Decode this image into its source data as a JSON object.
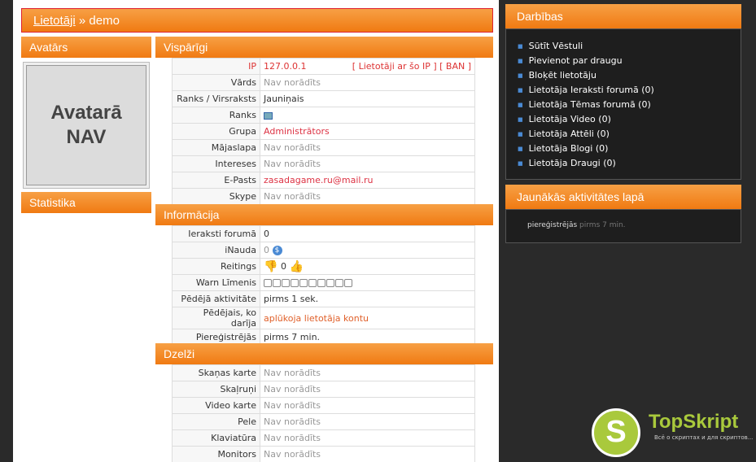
{
  "breadcrumb": {
    "link": "Lietotāji",
    "sep": " » ",
    "current": "demo"
  },
  "headers": {
    "avatars": "Avatārs",
    "visparigi": "Vispārīgi",
    "statistika": "Statistika",
    "informacija": "Informācija",
    "dzelzi": "Dzelži"
  },
  "avatar": {
    "line1": "Avatarā",
    "line2": "NAV"
  },
  "general": [
    {
      "k": "IP",
      "v": "127.0.0.1",
      "extra": "[ Lietotāji ar šo IP ] [ BAN ]"
    },
    {
      "k": "Vārds",
      "v": "Nav norādīts"
    },
    {
      "k": "Ranks / Virsraksts",
      "v": "Jauniņais"
    },
    {
      "k": "Ranks",
      "v": ""
    },
    {
      "k": "Grupa",
      "v": "Administrātors"
    },
    {
      "k": "Mājaslapa",
      "v": "Nav norādīts"
    },
    {
      "k": "Intereses",
      "v": "Nav norādīts"
    },
    {
      "k": "E-Pasts",
      "v": "zasadagame.ru@mail.ru"
    },
    {
      "k": "Skype",
      "v": "Nav norādīts"
    }
  ],
  "info": [
    {
      "k": "Ieraksti forumā",
      "v": "0"
    },
    {
      "k": "iNauda",
      "v": "0"
    },
    {
      "k": "Reitings",
      "v": "0"
    },
    {
      "k": "Warn Līmenis",
      "v": ""
    },
    {
      "k": "Pēdējā aktivitāte",
      "v": "pirms 1 sek."
    },
    {
      "k": "Pēdējais, ko darīja",
      "v": "aplūkoja lietotāja kontu"
    },
    {
      "k": "Piereģistrējās",
      "v": "pirms 7 min."
    }
  ],
  "hardware": [
    {
      "k": "Skaņas karte",
      "v": "Nav norādīts"
    },
    {
      "k": "Skaļruņi",
      "v": "Nav norādīts"
    },
    {
      "k": "Video karte",
      "v": "Nav norādīts"
    },
    {
      "k": "Pele",
      "v": "Nav norādīts"
    },
    {
      "k": "Klaviatūra",
      "v": "Nav norādīts"
    },
    {
      "k": "Monitors",
      "v": "Nav norādīts"
    }
  ],
  "actions": {
    "title": "Darbības",
    "items": [
      "Sūtīt Vēstuli",
      "Pievienot par draugu",
      "Bloķēt lietotāju",
      "Lietotāja Ieraksti forumā (0)",
      "Lietotāja Tēmas forumā (0)",
      "Lietotāja Video (0)",
      "Lietotāja Attēli (0)",
      "Lietotāja Blogi (0)",
      "Lietotāja Draugi (0)"
    ]
  },
  "activity": {
    "title": "Jaunākās aktivitātes lapā",
    "entry": "piereģistrējās",
    "time": "pirms 7 min."
  },
  "logo": {
    "letter": "S",
    "name": "TopSkript",
    "tagline": "Всё о скриптах и для скриптов..."
  }
}
